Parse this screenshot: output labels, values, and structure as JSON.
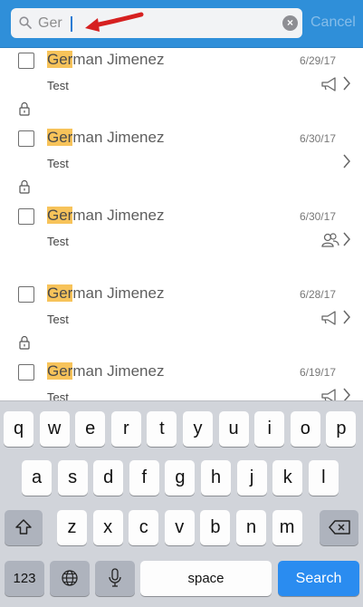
{
  "search": {
    "value": "Ger",
    "cancel_label": "Cancel"
  },
  "colors": {
    "header": "#2f8fd9",
    "highlight": "#f7c35a",
    "search_key": "#2a8cf0",
    "annotation_arrow": "#d62020"
  },
  "messages": [
    {
      "highlight": "Ger",
      "name_rest": "man Jimenez",
      "date": "6/29/17",
      "subject": "Test",
      "type_icon": "megaphone-icon",
      "locked": true
    },
    {
      "highlight": "Ger",
      "name_rest": "man Jimenez",
      "date": "6/30/17",
      "subject": "Test",
      "type_icon": "",
      "locked": true
    },
    {
      "highlight": "Ger",
      "name_rest": "man Jimenez",
      "date": "6/30/17",
      "subject": "Test",
      "type_icon": "group-icon",
      "locked": false
    },
    {
      "highlight": "Ger",
      "name_rest": "man Jimenez",
      "date": "6/28/17",
      "subject": "Test",
      "type_icon": "megaphone-icon",
      "locked": true
    },
    {
      "highlight": "Ger",
      "name_rest": "man Jimenez",
      "date": "6/19/17",
      "subject": "Test",
      "type_icon": "megaphone-icon",
      "locked": false
    }
  ],
  "keyboard": {
    "row1": [
      "q",
      "w",
      "e",
      "r",
      "t",
      "y",
      "u",
      "i",
      "o",
      "p"
    ],
    "row2": [
      "a",
      "s",
      "d",
      "f",
      "g",
      "h",
      "j",
      "k",
      "l"
    ],
    "row3": [
      "z",
      "x",
      "c",
      "v",
      "b",
      "n",
      "m"
    ],
    "numbers_label": "123",
    "space_label": "space",
    "search_label": "Search"
  }
}
